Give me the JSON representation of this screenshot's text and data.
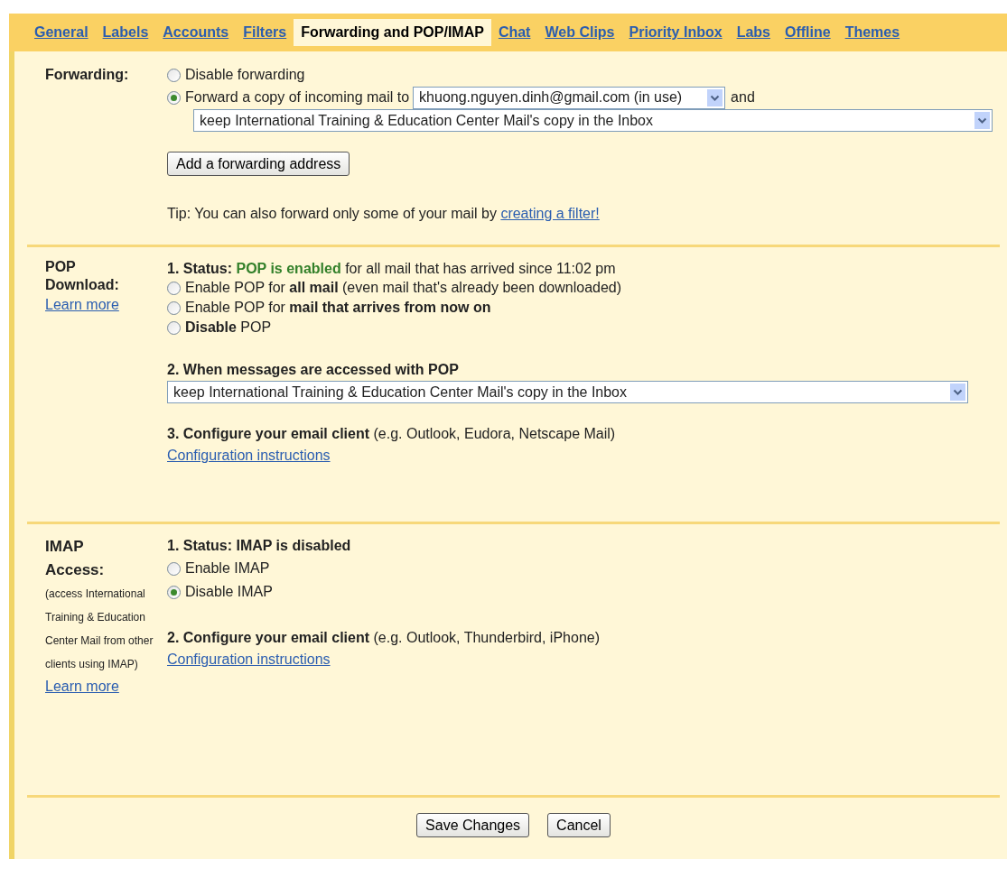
{
  "tabs": [
    {
      "label": "General",
      "selected": false
    },
    {
      "label": "Labels",
      "selected": false
    },
    {
      "label": "Accounts",
      "selected": false
    },
    {
      "label": "Filters",
      "selected": false
    },
    {
      "label": "Forwarding and POP/IMAP",
      "selected": true
    },
    {
      "label": "Chat",
      "selected": false
    },
    {
      "label": "Web Clips",
      "selected": false
    },
    {
      "label": "Priority Inbox",
      "selected": false
    },
    {
      "label": "Labs",
      "selected": false
    },
    {
      "label": "Offline",
      "selected": false
    },
    {
      "label": "Themes",
      "selected": false
    }
  ],
  "forwarding": {
    "label": "Forwarding:",
    "options": [
      {
        "label": "Disable forwarding",
        "selected": false
      },
      {
        "label": "Forward a copy of incoming mail to",
        "selected": true
      }
    ],
    "address": "khuong.nguyen.dinh@gmail.com (in use)",
    "connector": "and",
    "action": "keep International Training & Education Center Mail's copy in the Inbox",
    "add_button": "Add a forwarding address",
    "tip": "Tip: You can also forward only some of your mail by",
    "tip_link": "creating a filter!"
  },
  "pop": {
    "label": "POP Download:",
    "learn_more": "Learn more",
    "status_label": "1. Status:",
    "status_value": "POP is enabled",
    "status_rest": "for all mail that has arrived since 11:02 pm",
    "options": [
      {
        "label": "Enable POP for **all mail** (even mail that's already been downloaded)",
        "selected": false
      },
      {
        "label": "Enable POP for **mail that arrives from now on**",
        "selected": false
      },
      {
        "label": "**Disable** POP",
        "selected": false
      }
    ],
    "step2": "2. When messages are accessed with POP",
    "action": "keep International Training & Education Center Mail's copy in the Inbox",
    "step3": "**3. Configure your email client** (e.g. Outlook, Eudora, Netscape Mail)",
    "config_link": "Configuration instructions"
  },
  "imap": {
    "label": "IMAP Access:",
    "note": "(access International Training & Education Center Mail from other clients using IMAP)",
    "learn_more": "Learn more",
    "status": "1. Status: IMAP is disabled",
    "options": [
      {
        "label": "Enable IMAP",
        "selected": false
      },
      {
        "label": "Disable IMAP",
        "selected": true
      }
    ],
    "step2": "**2. Configure your email client** (e.g. Outlook, Thunderbird, iPhone)",
    "config_link": "Configuration instructions"
  },
  "footer": {
    "buttons": [
      "Save Changes",
      "Cancel"
    ]
  }
}
